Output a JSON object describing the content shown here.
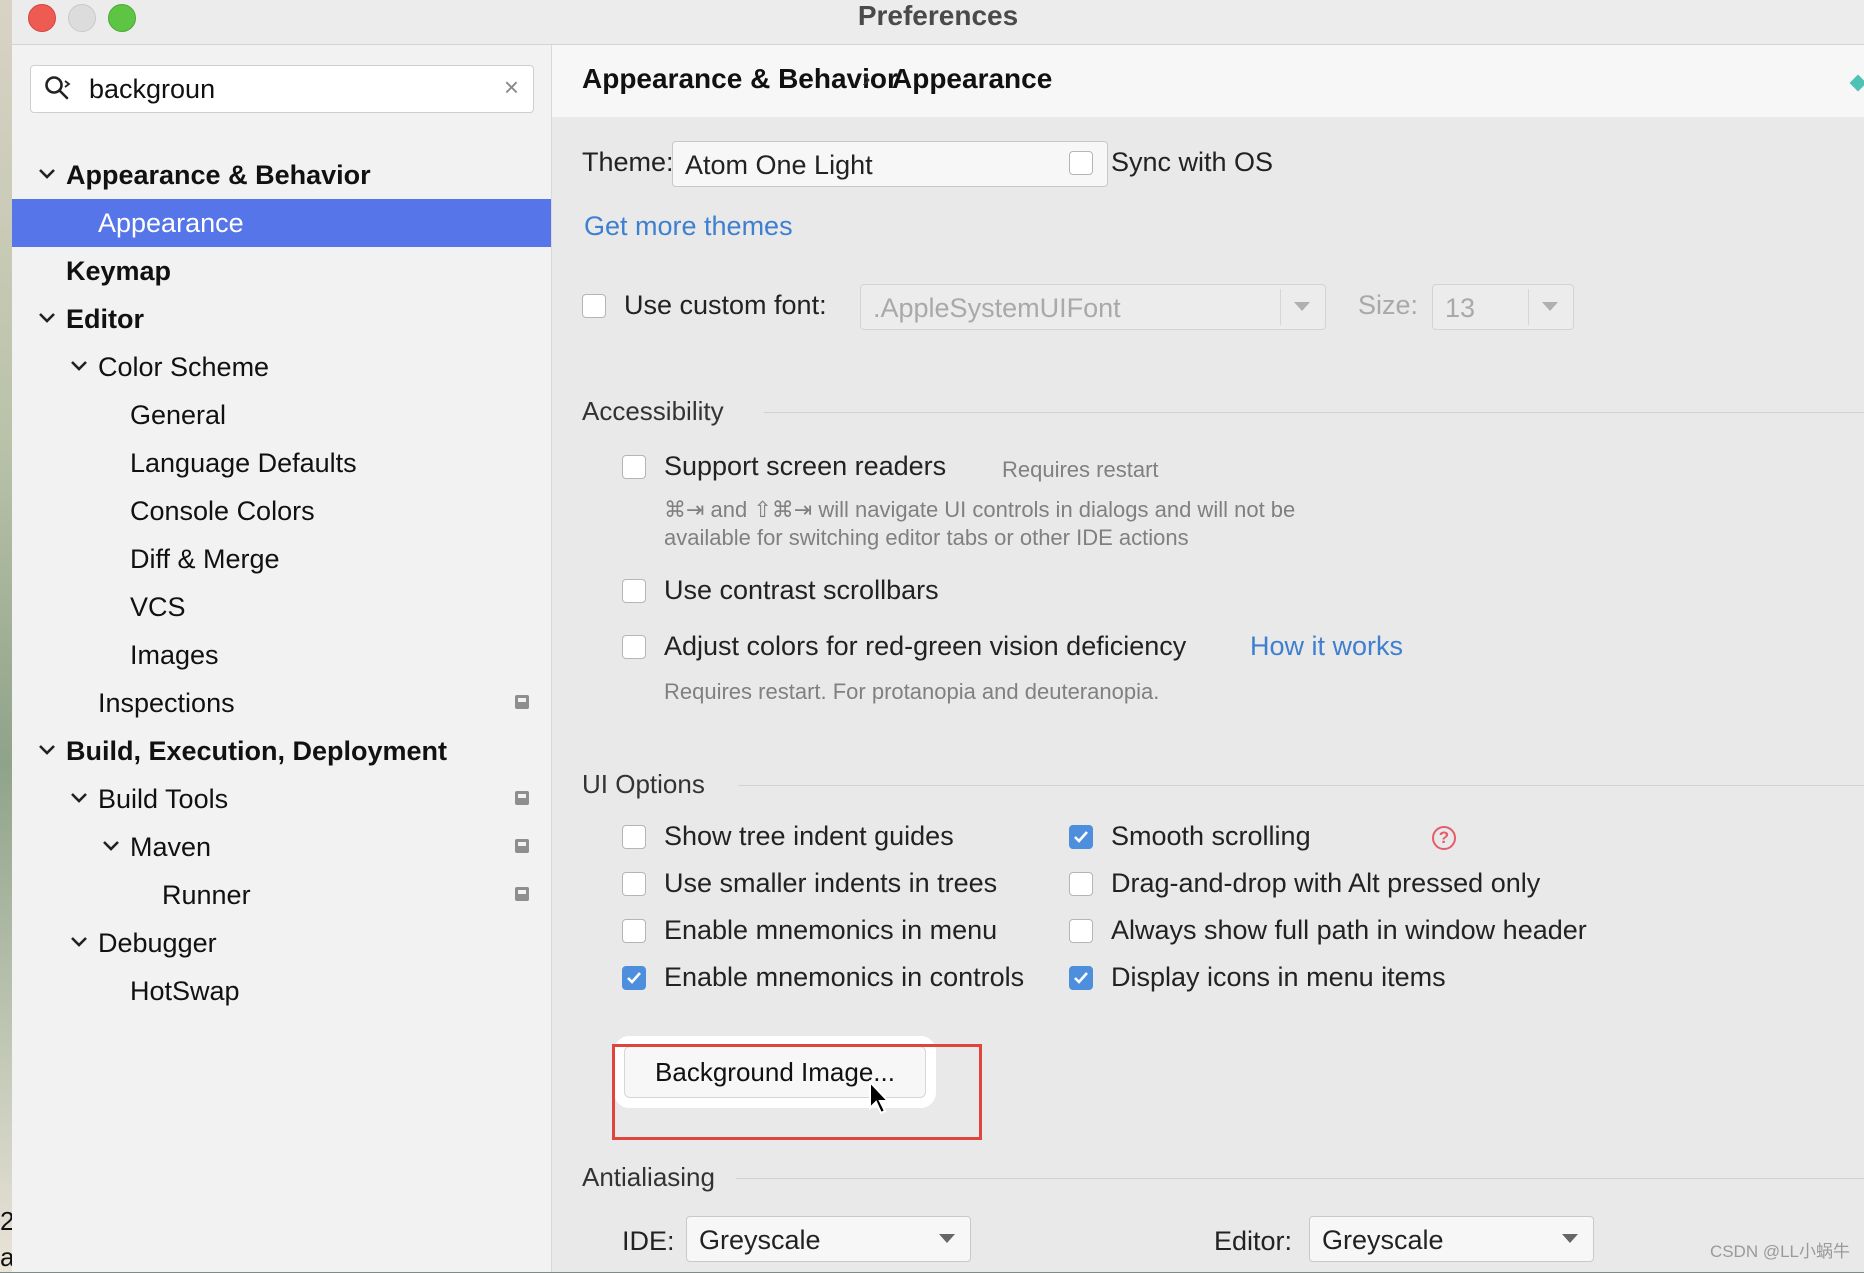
{
  "window": {
    "title": "Preferences"
  },
  "search": {
    "value": "backgroun"
  },
  "tree": [
    {
      "label": "Appearance & Behavior",
      "bold": true,
      "expanded": true,
      "indent": 0,
      "selected": false,
      "badge": false,
      "name": "tree-item-appearance-behavior"
    },
    {
      "label": "Appearance",
      "bold": false,
      "expanded": null,
      "indent": 1,
      "selected": true,
      "badge": false,
      "name": "tree-item-appearance"
    },
    {
      "label": "Keymap",
      "bold": true,
      "expanded": null,
      "indent": 0,
      "selected": false,
      "badge": false,
      "name": "tree-item-keymap"
    },
    {
      "label": "Editor",
      "bold": true,
      "expanded": true,
      "indent": 0,
      "selected": false,
      "badge": false,
      "name": "tree-item-editor"
    },
    {
      "label": "Color Scheme",
      "bold": false,
      "expanded": true,
      "indent": 1,
      "selected": false,
      "badge": false,
      "name": "tree-item-color-scheme"
    },
    {
      "label": "General",
      "bold": false,
      "expanded": null,
      "indent": 2,
      "selected": false,
      "badge": false,
      "name": "tree-item-general"
    },
    {
      "label": "Language Defaults",
      "bold": false,
      "expanded": null,
      "indent": 2,
      "selected": false,
      "badge": false,
      "name": "tree-item-language-defaults"
    },
    {
      "label": "Console Colors",
      "bold": false,
      "expanded": null,
      "indent": 2,
      "selected": false,
      "badge": false,
      "name": "tree-item-console-colors"
    },
    {
      "label": "Diff & Merge",
      "bold": false,
      "expanded": null,
      "indent": 2,
      "selected": false,
      "badge": false,
      "name": "tree-item-diff-merge"
    },
    {
      "label": "VCS",
      "bold": false,
      "expanded": null,
      "indent": 2,
      "selected": false,
      "badge": false,
      "name": "tree-item-vcs"
    },
    {
      "label": "Images",
      "bold": false,
      "expanded": null,
      "indent": 2,
      "selected": false,
      "badge": false,
      "name": "tree-item-images"
    },
    {
      "label": "Inspections",
      "bold": false,
      "expanded": null,
      "indent": 1,
      "selected": false,
      "badge": true,
      "name": "tree-item-inspections"
    },
    {
      "label": "Build, Execution, Deployment",
      "bold": true,
      "expanded": true,
      "indent": 0,
      "selected": false,
      "badge": false,
      "name": "tree-item-build-execution-deployment"
    },
    {
      "label": "Build Tools",
      "bold": false,
      "expanded": true,
      "indent": 1,
      "selected": false,
      "badge": true,
      "name": "tree-item-build-tools"
    },
    {
      "label": "Maven",
      "bold": false,
      "expanded": true,
      "indent": 2,
      "selected": false,
      "badge": true,
      "name": "tree-item-maven"
    },
    {
      "label": "Runner",
      "bold": false,
      "expanded": null,
      "indent": 3,
      "selected": false,
      "badge": true,
      "name": "tree-item-runner"
    },
    {
      "label": "Debugger",
      "bold": false,
      "expanded": true,
      "indent": 1,
      "selected": false,
      "badge": false,
      "name": "tree-item-debugger"
    },
    {
      "label": "HotSwap",
      "bold": false,
      "expanded": null,
      "indent": 2,
      "selected": false,
      "badge": false,
      "name": "tree-item-hotswap"
    }
  ],
  "breadcrumb": {
    "parent": "Appearance & Behavior",
    "separator": "›",
    "current": "Appearance"
  },
  "theme": {
    "label": "Theme:",
    "value": "Atom One Light",
    "sync_label": "Sync with OS",
    "sync_checked": false,
    "more_link": "Get more themes"
  },
  "font": {
    "checkbox_label": "Use custom font:",
    "checked": false,
    "value": ".AppleSystemUIFont",
    "size_label": "Size:",
    "size_value": "13"
  },
  "accessibility": {
    "title": "Accessibility",
    "screen_readers_label": "Support screen readers",
    "screen_readers_checked": false,
    "requires_restart": "Requires restart",
    "screen_readers_hint_line1": "⌘⇥ and ⇧⌘⇥ will navigate UI controls in dialogs and will not be",
    "screen_readers_hint_line2": "available for switching editor tabs or other IDE actions",
    "contrast_label": "Use contrast scrollbars",
    "contrast_checked": false,
    "colorblind_label": "Adjust colors for red-green vision deficiency",
    "colorblind_checked": false,
    "how_it_works": "How it works",
    "colorblind_hint": "Requires restart. For protanopia and deuteranopia."
  },
  "ui_options": {
    "title": "UI Options",
    "left": [
      {
        "label": "Show tree indent guides",
        "checked": false
      },
      {
        "label": "Use smaller indents in trees",
        "checked": false
      },
      {
        "label": "Enable mnemonics in menu",
        "checked": false
      },
      {
        "label": "Enable mnemonics in controls",
        "checked": true
      }
    ],
    "right": [
      {
        "label": "Smooth scrolling",
        "checked": true
      },
      {
        "label": "Drag-and-drop with Alt pressed only",
        "checked": false
      },
      {
        "label": "Always show full path in window header",
        "checked": false
      },
      {
        "label": "Display icons in menu items",
        "checked": true
      }
    ],
    "help_glyph": "?",
    "background_button": "Background Image..."
  },
  "antialiasing": {
    "title": "Antialiasing",
    "ide_label": "IDE:",
    "ide_value": "Greyscale",
    "editor_label": "Editor:",
    "editor_value": "Greyscale"
  },
  "desktop_edge": {
    "char_top": "2",
    "char_bottom": "a"
  },
  "watermark": "CSDN @LL小蜗牛",
  "colors": {
    "accent": "#5575e8",
    "link": "#3f7fd0",
    "check": "#4e8fdd",
    "highlight": "#e0443c"
  }
}
